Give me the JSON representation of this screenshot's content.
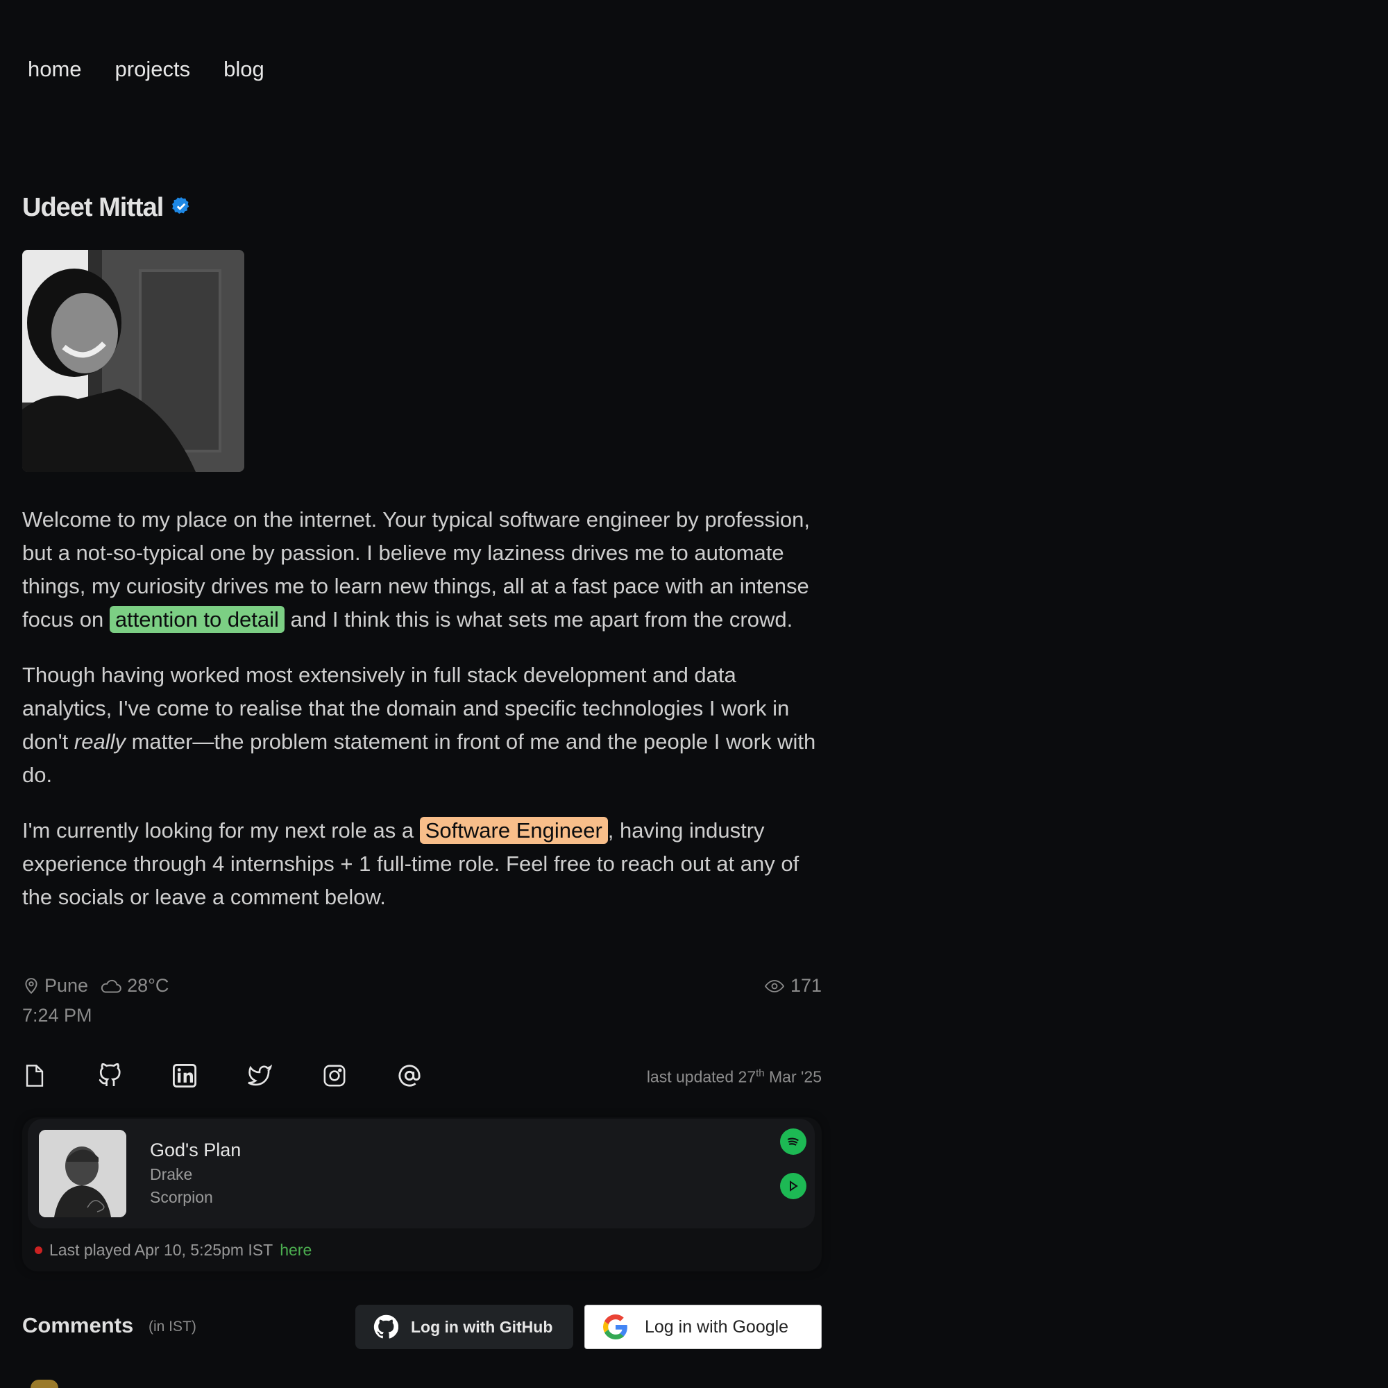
{
  "nav": {
    "items": [
      "home",
      "projects",
      "blog"
    ]
  },
  "profile": {
    "name": "Udeet Mittal",
    "verified_icon": "verified-badge-icon",
    "accent": "#1e88e5"
  },
  "about": {
    "p1_a": "Welcome to my place on the internet. Your typical software engineer by profession, but a not-so-typical one by passion. I believe my laziness drives me to automate things, my curiosity drives me to learn new things, all at a fast pace with an intense focus on ",
    "p1_hl": "attention to detail",
    "p1_b": " and I think this is what sets me apart from the crowd.",
    "p2_a": "Though having worked most extensively in full stack development and data analytics, I've come to realise that the domain and specific technologies I work in don't ",
    "p2_em": "really",
    "p2_b": " matter—the problem statement in front of me and the people I work with do.",
    "p3_a": "I'm currently looking for my next role as a ",
    "p3_hl": "Software Engineer",
    "p3_b": ", having industry experience through 4 internships + 1 full-time role. Feel free to reach out at any of the socials or leave a comment below.",
    "colors": {
      "highlight_green": "#7ccf84",
      "highlight_orange": "#f8be8a"
    }
  },
  "meta": {
    "location": "Pune",
    "temperature": "28°C",
    "time": "7:24 PM",
    "views": "171"
  },
  "socials": {
    "icons": [
      "resume-icon",
      "github-icon",
      "linkedin-icon",
      "twitter-icon",
      "instagram-icon",
      "email-at-icon"
    ],
    "updated_prefix": "last updated 27",
    "updated_sup": "th",
    "updated_suffix": " Mar '25"
  },
  "now_playing": {
    "song": "God's Plan",
    "artist": "Drake",
    "album": "Scorpion",
    "last_played": "Last played Apr 10, 5:25pm IST",
    "link": "here",
    "spotify_color": "#1db954"
  },
  "comments": {
    "title": "Comments",
    "timezone": "(in IST)",
    "github_btn": "Log in with GitHub",
    "google_btn": "Log in with Google"
  }
}
